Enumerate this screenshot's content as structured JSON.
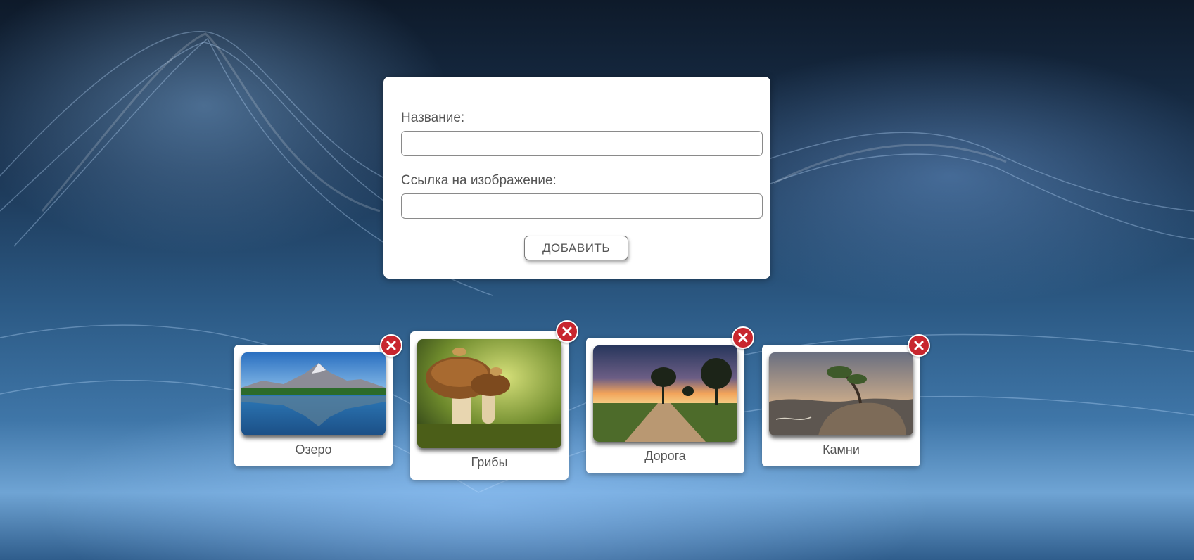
{
  "form": {
    "name_label": "Название:",
    "name_value": "",
    "link_label": "Ссылка на изображение:",
    "link_value": "",
    "add_button_label": "ДОБАВИТЬ"
  },
  "cards": [
    {
      "caption": "Озеро",
      "image": "lake-mountains-photo"
    },
    {
      "caption": "Грибы",
      "image": "mushrooms-photo"
    },
    {
      "caption": "Дорога",
      "image": "country-road-sunset-photo"
    },
    {
      "caption": "Камни",
      "image": "tree-on-rocks-photo"
    }
  ],
  "icons": {
    "delete": "close-icon"
  },
  "colors": {
    "delete_button": "#c8262e",
    "card_background": "#ffffff",
    "text": "#555555"
  }
}
